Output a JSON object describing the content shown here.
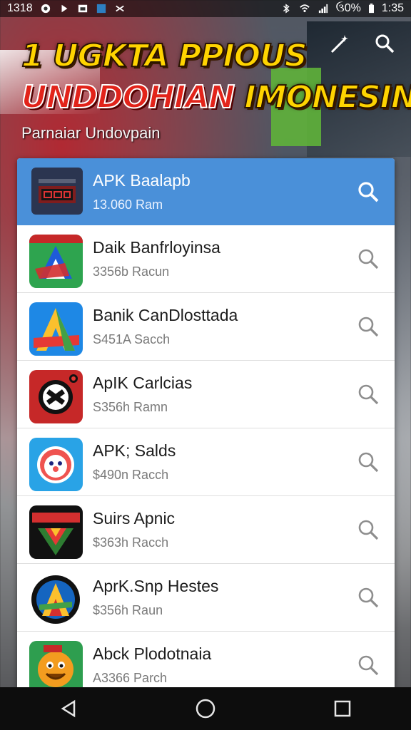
{
  "status_bar": {
    "time_left": "1318",
    "battery": "ઉ0%",
    "clock": "1:35"
  },
  "header": {
    "title_line1": "1 UGKTA PPIOUS",
    "title_line2_a": "UNDDOHIAN",
    "title_line2_b": "IMONESIN",
    "subtitle": "Parnaiar Undovpain"
  },
  "list": {
    "selected": {
      "name": "APK Baalapb",
      "meta": "13.060 Ram",
      "icon": "app-icon-blue-grey"
    },
    "items": [
      {
        "name": "Daik Banfrloyinsa",
        "meta": "3356b Racun",
        "icon": "app-icon-green-a"
      },
      {
        "name": "Banik CanDlosttada",
        "meta": "S451A Sacch",
        "icon": "app-icon-blue-a"
      },
      {
        "name": "ApIK Carlcias",
        "meta": "S356h Ramn",
        "icon": "app-icon-red-gamepad"
      },
      {
        "name": "APK; Salds",
        "meta": "$490n Racch",
        "icon": "app-icon-blue-face"
      },
      {
        "name": "Suirs Apnic",
        "meta": "$363h Racch",
        "icon": "app-icon-black-v"
      },
      {
        "name": "AprK.Snp Hestes",
        "meta": "$356h Raun",
        "icon": "app-icon-badge-a"
      },
      {
        "name": "Abck Plodotnaia",
        "meta": "A3366 Parch",
        "icon": "app-icon-green-smiley"
      }
    ]
  },
  "colors": {
    "selected_row": "#4a90d9",
    "title_yellow": "#ffd400",
    "title_red": "#e2231a"
  }
}
